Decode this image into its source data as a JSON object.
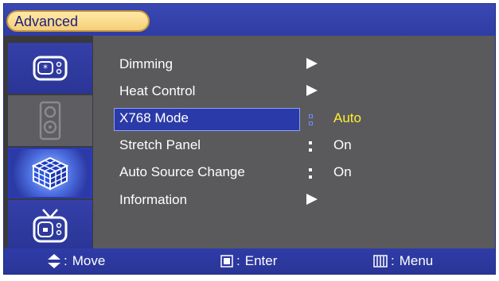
{
  "header": {
    "title": "Advanced"
  },
  "sidebar": {
    "items": [
      {
        "icon": "monitor-settings-icon",
        "selected": false
      },
      {
        "icon": "speaker-icon",
        "selected": false
      },
      {
        "icon": "cube-icon",
        "selected": true
      },
      {
        "icon": "tv-icon",
        "selected": false
      }
    ]
  },
  "menu": {
    "items": [
      {
        "label": "Dimming",
        "type": "submenu"
      },
      {
        "label": "Heat Control",
        "type": "submenu"
      },
      {
        "label": "X768 Mode",
        "type": "value",
        "value": "Auto",
        "selected": true
      },
      {
        "label": "Stretch Panel",
        "type": "value",
        "value": "On"
      },
      {
        "label": "Auto Source Change",
        "type": "value",
        "value": "On"
      },
      {
        "label": "Information",
        "type": "submenu"
      }
    ]
  },
  "footer": {
    "move": "Move",
    "enter": "Enter",
    "menu": "Menu",
    "separator": ":"
  },
  "colors": {
    "bar_blue": "#2f3ca3",
    "panel_gray": "#5a5a5c",
    "sidebar_gray": "#3a3a3c",
    "title_pill": "#f5cf7a",
    "highlight": "#2a3aa8",
    "selected_value": "#ffee33"
  }
}
